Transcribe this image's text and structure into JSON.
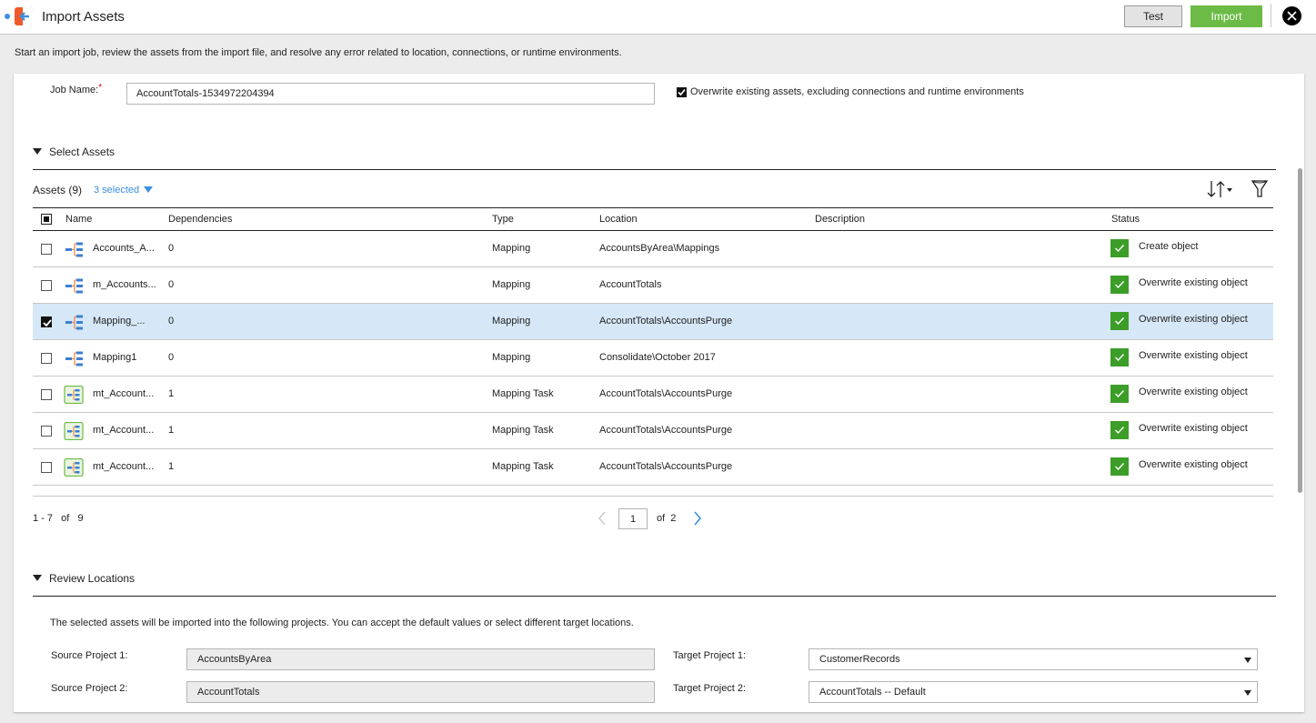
{
  "header": {
    "title": "Import Assets",
    "test_label": "Test",
    "import_label": "Import"
  },
  "intro": "Start an import job, review the assets from the import file, and resolve any error related to location, connections, or runtime environments.",
  "job": {
    "label": "Job Name:",
    "required_mark": "*",
    "value": "AccountTotals-1534972204394",
    "overwrite_checked": true,
    "overwrite_label": "Overwrite existing assets, excluding connections and runtime environments"
  },
  "select_assets": {
    "section_title": "Select Assets",
    "count_label": "Assets (9)",
    "selected_label": "3 selected",
    "columns": [
      "Name",
      "Dependencies",
      "Type",
      "Location",
      "Description",
      "Status"
    ],
    "rows": [
      {
        "checked": false,
        "icon": "mapping-icon",
        "name": "Accounts_A...",
        "dependencies": "0",
        "type": "Mapping",
        "location": "AccountsByArea\\Mappings",
        "description": "",
        "status": "Create object"
      },
      {
        "checked": false,
        "icon": "mapping-icon",
        "name": "m_Accounts...",
        "dependencies": "0",
        "type": "Mapping",
        "location": "AccountTotals",
        "description": "",
        "status": "Overwrite existing object"
      },
      {
        "checked": true,
        "icon": "mapping-icon",
        "name": "Mapping_...",
        "dependencies": "0",
        "type": "Mapping",
        "location": "AccountTotals\\AccountsPurge",
        "description": "",
        "status": "Overwrite existing object"
      },
      {
        "checked": false,
        "icon": "mapping-icon",
        "name": "Mapping1",
        "dependencies": "0",
        "type": "Mapping",
        "location": "Consolidate\\October 2017",
        "description": "",
        "status": "Overwrite existing object"
      },
      {
        "checked": false,
        "icon": "mapping-task-icon",
        "name": "mt_Account...",
        "dependencies": "1",
        "type": "Mapping Task",
        "location": "AccountTotals\\AccountsPurge",
        "description": "",
        "status": "Overwrite existing object"
      },
      {
        "checked": false,
        "icon": "mapping-task-icon",
        "name": "mt_Account...",
        "dependencies": "1",
        "type": "Mapping Task",
        "location": "AccountTotals\\AccountsPurge",
        "description": "",
        "status": "Overwrite existing object"
      },
      {
        "checked": false,
        "icon": "mapping-task-icon",
        "name": "mt_Account...",
        "dependencies": "1",
        "type": "Mapping Task",
        "location": "AccountTotals\\AccountsPurge",
        "description": "",
        "status": "Overwrite existing object"
      }
    ],
    "pagination": {
      "range": "1 - 7   of   9",
      "page": "1",
      "of_label": "of  2"
    }
  },
  "review_locations": {
    "section_title": "Review Locations",
    "description": "The selected assets will be imported into the following projects. You can accept the default values or select different target locations.",
    "source": [
      {
        "label": "Source Project 1:",
        "value": "AccountsByArea"
      },
      {
        "label": "Source Project 2:",
        "value": "AccountTotals"
      }
    ],
    "target": [
      {
        "label": "Target Project 1:",
        "value": "CustomerRecords"
      },
      {
        "label": "Target Project 2:",
        "value": "AccountTotals -- Default"
      }
    ]
  },
  "colors": {
    "accent": "#3b8fe0",
    "import_button": "#6cbb46",
    "status_ok": "#3c9e28",
    "selected_row": "#d6e8f8",
    "logo": "#f05a28"
  }
}
